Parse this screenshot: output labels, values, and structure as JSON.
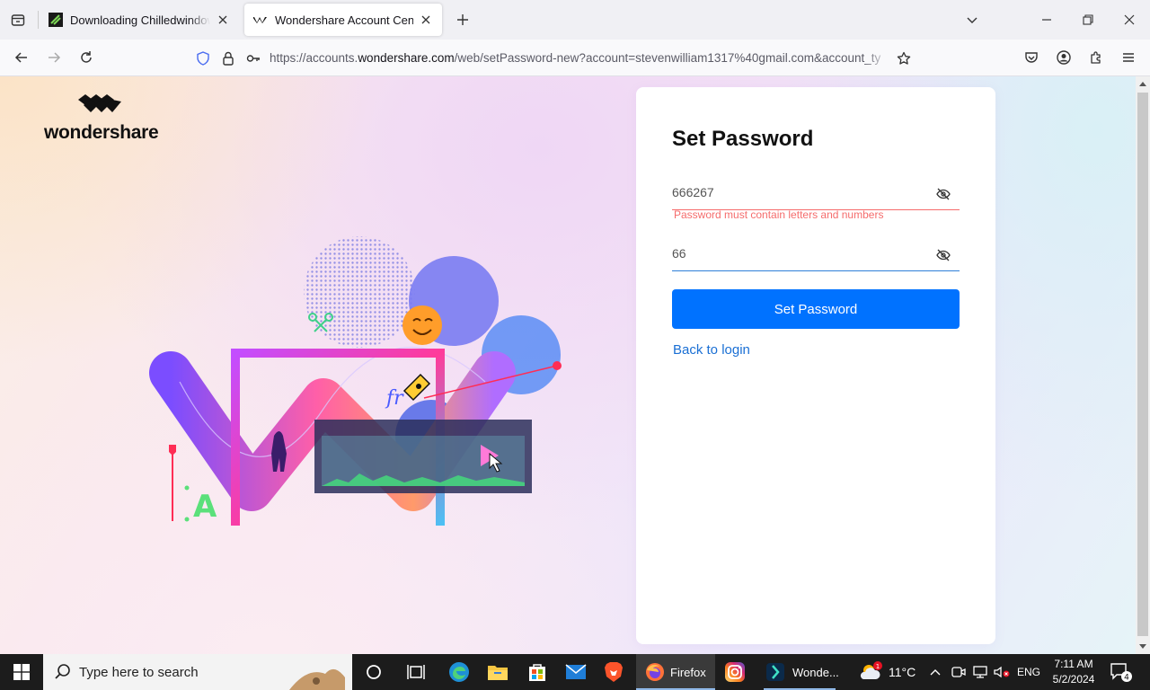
{
  "browser": {
    "tabs": [
      {
        "title": "Downloading Chilledwindows.exe",
        "active": false
      },
      {
        "title": "Wondershare Account Center",
        "active": true
      }
    ],
    "url": {
      "prefix": "https://accounts.",
      "domain": "wondershare.com",
      "path": "/web/setPassword-new?account=stevenwilliam1317%40gmail.com&account_ty"
    }
  },
  "page": {
    "logo_text": "wondershare",
    "form": {
      "title": "Set Password",
      "password_value": "666267",
      "password_error": "Password must contain letters and numbers",
      "confirm_value": "66",
      "submit_label": "Set Password",
      "back_link": "Back to login"
    },
    "colors": {
      "primary": "#0072ff",
      "error": "#f56c6c",
      "link": "#1a6fd4"
    }
  },
  "taskbar": {
    "search_placeholder": "Type here to search",
    "firefox_label": "Firefox",
    "wondershare_label": "Wonde...",
    "temperature": "11°C",
    "language": "ENG",
    "time": "7:11 AM",
    "date": "5/2/2024",
    "notification_count": "4",
    "weather_badge": "1"
  }
}
